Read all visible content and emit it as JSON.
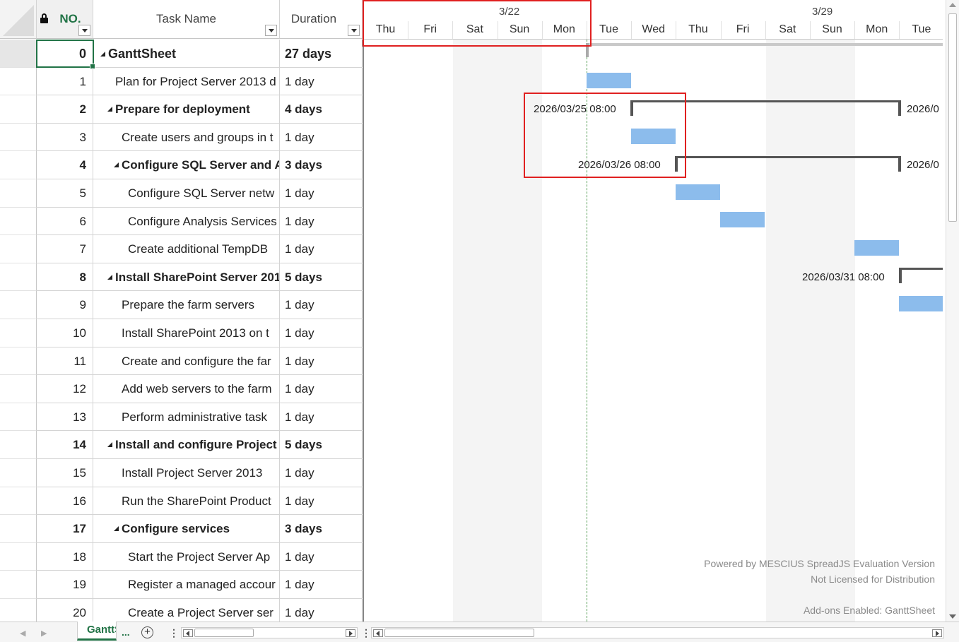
{
  "columns": {
    "no": "NO.",
    "task_name": "Task Name",
    "duration": "Duration"
  },
  "rows": [
    {
      "no": "0",
      "name": "GanttSheet",
      "duration": "27 days",
      "level": 0,
      "summary": true
    },
    {
      "no": "1",
      "name": "Plan for Project Server 2013 d",
      "duration": "1 day",
      "level": 1,
      "summary": false
    },
    {
      "no": "2",
      "name": "Prepare for deployment",
      "duration": "4 days",
      "level": 1,
      "summary": true
    },
    {
      "no": "3",
      "name": "Create users and groups in t",
      "duration": "1 day",
      "level": 2,
      "summary": false
    },
    {
      "no": "4",
      "name": "Configure SQL Server and A",
      "duration": "3 days",
      "level": 2,
      "summary": true
    },
    {
      "no": "5",
      "name": "Configure SQL Server netw",
      "duration": "1 day",
      "level": 3,
      "summary": false
    },
    {
      "no": "6",
      "name": "Configure Analysis Services",
      "duration": "1 day",
      "level": 3,
      "summary": false
    },
    {
      "no": "7",
      "name": "Create additional TempDB",
      "duration": "1 day",
      "level": 3,
      "summary": false
    },
    {
      "no": "8",
      "name": "Install SharePoint Server 201",
      "duration": "5 days",
      "level": 1,
      "summary": true
    },
    {
      "no": "9",
      "name": "Prepare the farm servers",
      "duration": "1 day",
      "level": 2,
      "summary": false
    },
    {
      "no": "10",
      "name": "Install SharePoint 2013 on t",
      "duration": "1 day",
      "level": 2,
      "summary": false
    },
    {
      "no": "11",
      "name": "Create and configure the far",
      "duration": "1 day",
      "level": 2,
      "summary": false
    },
    {
      "no": "12",
      "name": "Add web servers to the farm",
      "duration": "1 day",
      "level": 2,
      "summary": false
    },
    {
      "no": "13",
      "name": "Perform administrative task",
      "duration": "1 day",
      "level": 2,
      "summary": false
    },
    {
      "no": "14",
      "name": "Install and configure Project",
      "duration": "5 days",
      "level": 1,
      "summary": true
    },
    {
      "no": "15",
      "name": "Install Project Server 2013",
      "duration": "1 day",
      "level": 2,
      "summary": false
    },
    {
      "no": "16",
      "name": "Run the SharePoint Product",
      "duration": "1 day",
      "level": 2,
      "summary": false
    },
    {
      "no": "17",
      "name": "Configure services",
      "duration": "3 days",
      "level": 2,
      "summary": true
    },
    {
      "no": "18",
      "name": "Start the Project Server Ap",
      "duration": "1 day",
      "level": 3,
      "summary": false
    },
    {
      "no": "19",
      "name": "Register a managed accour",
      "duration": "1 day",
      "level": 3,
      "summary": false
    },
    {
      "no": "20",
      "name": "Create a Project Server ser",
      "duration": "1 day",
      "level": 3,
      "summary": false
    }
  ],
  "timescale": {
    "weeks": [
      "3/22",
      "3/29"
    ],
    "days": [
      "Thu",
      "Fri",
      "Sat",
      "Sun",
      "Mon",
      "Tue",
      "Wed",
      "Thu",
      "Fri",
      "Sat",
      "Sun",
      "Mon",
      "Tue"
    ]
  },
  "gantt": {
    "labels": {
      "row2_start": "2026/03/25 08:00",
      "row2_end": "2026/0",
      "row4_start": "2026/03/26 08:00",
      "row4_end": "2026/0",
      "row8_start": "2026/03/31 08:00"
    },
    "bar_color": "#8cbcec"
  },
  "watermark": {
    "line1": "Powered by MESCIUS SpreadJS Evaluation Version",
    "line2": "Not Licensed for Distribution",
    "line3": "Add-ons Enabled: GanttSheet"
  },
  "tabs": {
    "active": "GanttSheet",
    "more": "...",
    "add": "+"
  },
  "accent_color": "#217346"
}
